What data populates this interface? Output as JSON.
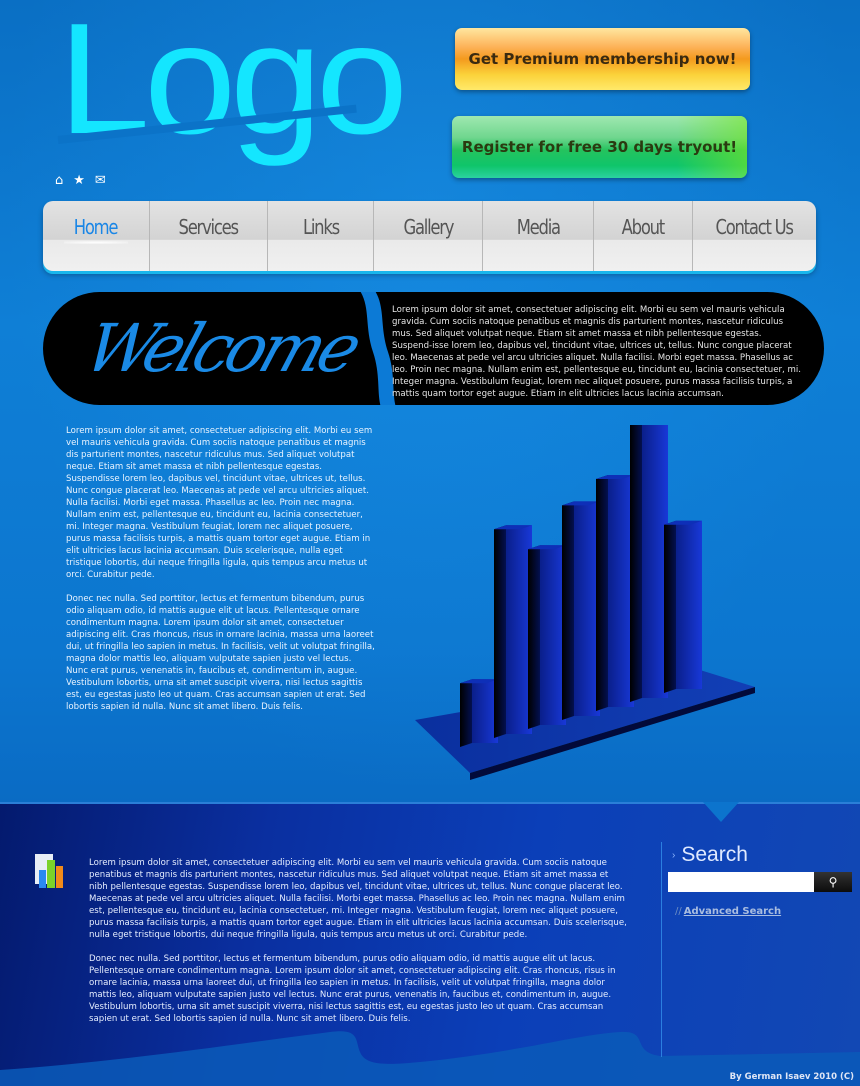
{
  "header": {
    "logo_text": "Logo",
    "mini_icons": [
      "home-icon",
      "star-icon",
      "mail-icon"
    ],
    "premium_button": "Get Premium membership now!",
    "register_button": "Register for free 30 days tryout!"
  },
  "nav": {
    "items": [
      {
        "label": "Home",
        "active": true
      },
      {
        "label": "Services",
        "active": false
      },
      {
        "label": "Links",
        "active": false
      },
      {
        "label": "Gallery",
        "active": false
      },
      {
        "label": "Media",
        "active": false
      },
      {
        "label": "About",
        "active": false
      },
      {
        "label": "Contact Us",
        "active": false
      }
    ]
  },
  "welcome": {
    "title": "Welcome",
    "text": "Lorem ipsum dolor sit amet, consectetuer adipiscing elit. Morbi eu sem vel mauris vehicula gravida. Cum sociis natoque penatibus et magnis dis parturient montes, nascetur ridiculus mus. Sed aliquet volutpat neque. Etiam sit amet massa et nibh pellentesque egestas. Suspend-isse lorem leo, dapibus vel, tincidunt vitae, ultrices ut, tellus. Nunc congue placerat leo. Maecenas at pede vel arcu ultricies aliquet. Nulla facilisi. Morbi eget massa. Phasellus ac leo. Proin nec magna. Nullam enim est, pellentesque eu, tincidunt eu, lacinia consectetuer, mi. Integer magna. Vestibulum feugiat, lorem nec aliquet posuere, purus massa facilisis turpis, a mattis quam tortor eget augue. Etiam in elit ultricies lacus lacinia accumsan."
  },
  "main": {
    "paragraphs": [
      "Lorem ipsum dolor sit amet, consectetuer adipiscing elit. Morbi eu sem vel mauris vehicula gravida. Cum sociis natoque penatibus et magnis dis parturient montes, nascetur ridiculus mus. Sed aliquet volutpat neque. Etiam sit amet massa et nibh pellentesque egestas. Suspendisse lorem leo, dapibus vel, tincidunt vitae, ultrices ut, tellus. Nunc congue placerat leo. Maecenas at pede vel arcu ultricies aliquet. Nulla facilisi. Morbi eget massa. Phasellus ac leo. Proin nec magna. Nullam enim est, pellentesque eu, tincidunt eu, lacinia consectetuer, mi. Integer magna. Vestibulum feugiat, lorem nec aliquet posuere, purus massa facilisis turpis, a mattis quam tortor eget augue. Etiam in elit ultricies lacus lacinia accumsan. Duis scelerisque, nulla eget tristique lobortis, dui neque fringilla ligula, quis tempus arcu metus ut orci. Curabitur pede.",
      "Donec nec nulla. Sed porttitor, lectus et fermentum bibendum, purus odio aliquam odio, id mattis augue elit ut lacus. Pellentesque ornare condimentum magna. Lorem ipsum dolor sit amet, consectetuer adipiscing elit. Cras rhoncus, risus in ornare lacinia, massa urna laoreet dui, ut fringilla leo sapien in metus. In facilisis, velit ut volutpat fringilla, magna dolor mattis leo, aliquam vulputate sapien justo vel lectus. Nunc erat purus, venenatis in, faucibus et, condimentum in, augue. Vestibulum lobortis, urna sit amet suscipit viverra, nisi lectus sagittis est, eu egestas justo leo ut quam. Cras accumsan sapien ut erat. Sed lobortis sapien id nulla. Nunc sit amet libero. Duis felis."
    ],
    "illustration": {
      "type": "decorative-3d-bar-chart",
      "relative_heights": [
        0.22,
        0.72,
        0.62,
        0.74,
        0.8,
        1.0,
        0.58
      ]
    }
  },
  "footer": {
    "paragraphs": [
      "Lorem ipsum dolor sit amet, consectetuer adipiscing elit. Morbi eu sem vel mauris vehicula gravida. Cum sociis natoque penatibus et magnis dis parturient montes, nascetur ridiculus mus. Sed aliquet volutpat neque. Etiam sit amet massa et nibh pellentesque egestas. Suspendisse lorem leo, dapibus vel, tincidunt vitae, ultrices ut, tellus. Nunc congue placerat leo. Maecenas at pede vel arcu ultricies aliquet. Nulla facilisi. Morbi eget massa. Phasellus ac leo. Proin nec magna. Nullam enim est, pellentesque eu, tincidunt eu, lacinia consectetuer, mi. Integer magna. Vestibulum feugiat, lorem nec aliquet posuere, purus massa facilisis turpis, a mattis quam tortor eget augue. Etiam in elit ultricies lacus lacinia accumsan. Duis scelerisque, nulla eget tristique lobortis, dui neque fringilla ligula, quis tempus arcu metus ut orci. Curabitur pede.",
      "Donec nec nulla. Sed porttitor, lectus et fermentum bibendum, purus odio aliquam odio, id mattis augue elit ut lacus. Pellentesque ornare condimentum magna. Lorem ipsum dolor sit amet, consectetuer adipiscing elit. Cras rhoncus, risus in ornare lacinia, massa urna laoreet dui, ut fringilla leo sapien in metus. In facilisis, velit ut volutpat fringilla, magna dolor mattis leo, aliquam vulputate sapien justo vel lectus. Nunc erat purus, venenatis in, faucibus et, condimentum in, augue. Vestibulum lobortis, urna sit amet suscipit viverra, nisi lectus sagittis est, eu egestas justo leo ut quam. Cras accumsan sapien ut erat. Sed lobortis sapien id nulla. Nunc sit amet libero. Duis felis."
    ],
    "search": {
      "title": "Search",
      "placeholder": "",
      "value": "",
      "button_icon": "search-icon",
      "advanced_prefix": "//",
      "advanced_link": "Advanced Search"
    },
    "credit": "By German Isaev 2010 (C)"
  },
  "colors": {
    "logo": "#14e6ff",
    "nav_active": "#1a86e6",
    "welcome_script": "#1a8ae6",
    "footer_bg": "#0a2fa0"
  }
}
